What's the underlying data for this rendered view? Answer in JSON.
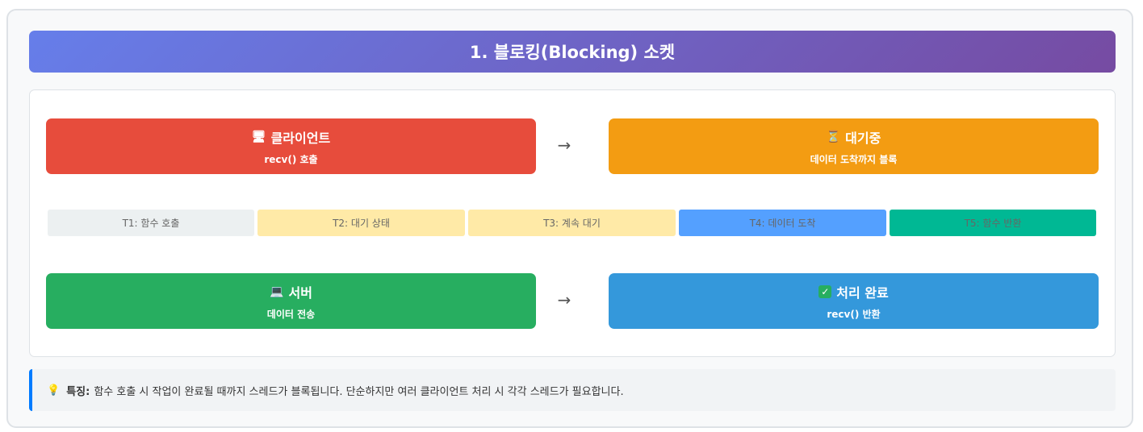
{
  "title": "1. 블로킹(Blocking) 소켓",
  "boxes": {
    "client": {
      "icon": "🖥",
      "icon_name": "computer-icon",
      "title": "클라이언트",
      "sub": "recv() 호출",
      "color": "#e74c3c"
    },
    "waiting": {
      "icon": "⏳",
      "icon_name": "hourglass-icon",
      "title": "대기중",
      "sub": "데이터 도착까지 블록",
      "color": "#f39c12"
    },
    "server": {
      "icon": "💻",
      "icon_name": "laptop-icon",
      "title": "서버",
      "sub": "데이터 전송",
      "color": "#27ae60"
    },
    "done": {
      "icon": "✓",
      "icon_name": "check-icon",
      "title": "처리 완료",
      "sub": "recv() 반환",
      "color": "#3498db"
    }
  },
  "arrows": [
    "→",
    "→"
  ],
  "timeline": [
    {
      "label": "T1: 함수 호출",
      "color": "#ecf0f1"
    },
    {
      "label": "T2: 대기 상태",
      "color": "#ffeaa7"
    },
    {
      "label": "T3: 계속 대기",
      "color": "#ffeaa7"
    },
    {
      "label": "T4: 데이터 도착",
      "color": "#54a0ff"
    },
    {
      "label": "T5: 함수 반환",
      "color": "#00b894"
    }
  ],
  "note": {
    "icon": "💡",
    "icon_name": "lightbulb-icon",
    "label": "특징:",
    "text": "함수 호출 시 작업이 완료될 때까지 스레드가 블록됩니다. 단순하지만 여러 클라이언트 처리 시 각각 스레드가 필요합니다.",
    "accent": "#007bff"
  }
}
